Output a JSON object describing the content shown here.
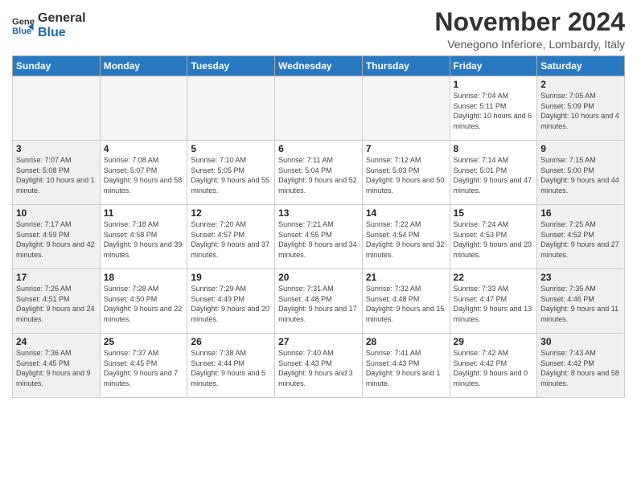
{
  "logo": {
    "line1": "General",
    "line2": "Blue"
  },
  "title": "November 2024",
  "location": "Venegono Inferiore, Lombardy, Italy",
  "weekdays": [
    "Sunday",
    "Monday",
    "Tuesday",
    "Wednesday",
    "Thursday",
    "Friday",
    "Saturday"
  ],
  "days": {
    "1": {
      "sunrise": "7:04 AM",
      "sunset": "5:11 PM",
      "daylight": "10 hours and 6 minutes."
    },
    "2": {
      "sunrise": "7:05 AM",
      "sunset": "5:09 PM",
      "daylight": "10 hours and 4 minutes."
    },
    "3": {
      "sunrise": "7:07 AM",
      "sunset": "5:08 PM",
      "daylight": "10 hours and 1 minute."
    },
    "4": {
      "sunrise": "7:08 AM",
      "sunset": "5:07 PM",
      "daylight": "9 hours and 58 minutes."
    },
    "5": {
      "sunrise": "7:10 AM",
      "sunset": "5:05 PM",
      "daylight": "9 hours and 55 minutes."
    },
    "6": {
      "sunrise": "7:11 AM",
      "sunset": "5:04 PM",
      "daylight": "9 hours and 52 minutes."
    },
    "7": {
      "sunrise": "7:12 AM",
      "sunset": "5:03 PM",
      "daylight": "9 hours and 50 minutes."
    },
    "8": {
      "sunrise": "7:14 AM",
      "sunset": "5:01 PM",
      "daylight": "9 hours and 47 minutes."
    },
    "9": {
      "sunrise": "7:15 AM",
      "sunset": "5:00 PM",
      "daylight": "9 hours and 44 minutes."
    },
    "10": {
      "sunrise": "7:17 AM",
      "sunset": "4:59 PM",
      "daylight": "9 hours and 42 minutes."
    },
    "11": {
      "sunrise": "7:18 AM",
      "sunset": "4:58 PM",
      "daylight": "9 hours and 39 minutes."
    },
    "12": {
      "sunrise": "7:20 AM",
      "sunset": "4:57 PM",
      "daylight": "9 hours and 37 minutes."
    },
    "13": {
      "sunrise": "7:21 AM",
      "sunset": "4:55 PM",
      "daylight": "9 hours and 34 minutes."
    },
    "14": {
      "sunrise": "7:22 AM",
      "sunset": "4:54 PM",
      "daylight": "9 hours and 32 minutes."
    },
    "15": {
      "sunrise": "7:24 AM",
      "sunset": "4:53 PM",
      "daylight": "9 hours and 29 minutes."
    },
    "16": {
      "sunrise": "7:25 AM",
      "sunset": "4:52 PM",
      "daylight": "9 hours and 27 minutes."
    },
    "17": {
      "sunrise": "7:26 AM",
      "sunset": "4:51 PM",
      "daylight": "9 hours and 24 minutes."
    },
    "18": {
      "sunrise": "7:28 AM",
      "sunset": "4:50 PM",
      "daylight": "9 hours and 22 minutes."
    },
    "19": {
      "sunrise": "7:29 AM",
      "sunset": "4:49 PM",
      "daylight": "9 hours and 20 minutes."
    },
    "20": {
      "sunrise": "7:31 AM",
      "sunset": "4:48 PM",
      "daylight": "9 hours and 17 minutes."
    },
    "21": {
      "sunrise": "7:32 AM",
      "sunset": "4:48 PM",
      "daylight": "9 hours and 15 minutes."
    },
    "22": {
      "sunrise": "7:33 AM",
      "sunset": "4:47 PM",
      "daylight": "9 hours and 13 minutes."
    },
    "23": {
      "sunrise": "7:35 AM",
      "sunset": "4:46 PM",
      "daylight": "9 hours and 11 minutes."
    },
    "24": {
      "sunrise": "7:36 AM",
      "sunset": "4:45 PM",
      "daylight": "9 hours and 9 minutes."
    },
    "25": {
      "sunrise": "7:37 AM",
      "sunset": "4:45 PM",
      "daylight": "9 hours and 7 minutes."
    },
    "26": {
      "sunrise": "7:38 AM",
      "sunset": "4:44 PM",
      "daylight": "9 hours and 5 minutes."
    },
    "27": {
      "sunrise": "7:40 AM",
      "sunset": "4:43 PM",
      "daylight": "9 hours and 3 minutes."
    },
    "28": {
      "sunrise": "7:41 AM",
      "sunset": "4:43 PM",
      "daylight": "9 hours and 1 minute."
    },
    "29": {
      "sunrise": "7:42 AM",
      "sunset": "4:42 PM",
      "daylight": "9 hours and 0 minutes."
    },
    "30": {
      "sunrise": "7:43 AM",
      "sunset": "4:42 PM",
      "daylight": "8 hours and 58 minutes."
    }
  }
}
